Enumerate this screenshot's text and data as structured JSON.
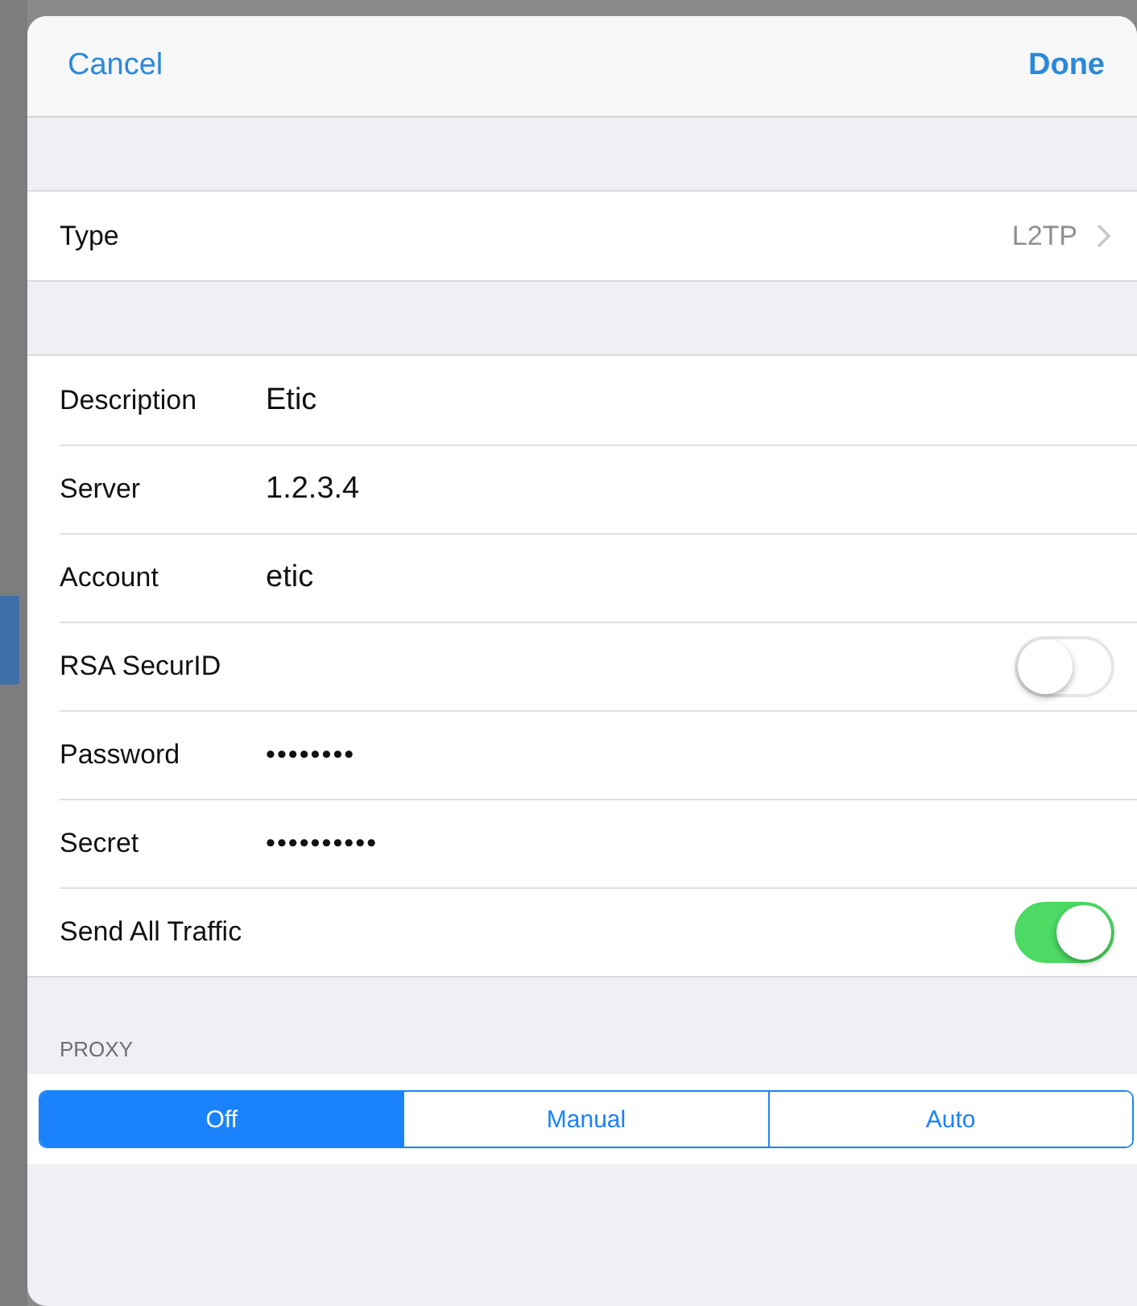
{
  "nav": {
    "cancel": "Cancel",
    "done": "Done"
  },
  "type_row": {
    "label": "Type",
    "value": "L2TP"
  },
  "fields": [
    {
      "kind": "text",
      "label": "Description",
      "value": "Etic"
    },
    {
      "kind": "text",
      "label": "Server",
      "value": "1.2.3.4"
    },
    {
      "kind": "text",
      "label": "Account",
      "value": "etic"
    },
    {
      "kind": "toggle",
      "label": "RSA SecurID",
      "on": false
    },
    {
      "kind": "secure",
      "label": "Password",
      "value": "••••••••"
    },
    {
      "kind": "secure",
      "label": "Secret",
      "value": "••••••••••"
    },
    {
      "kind": "toggle",
      "label": "Send All Traffic",
      "on": true
    }
  ],
  "proxy": {
    "header": "PROXY",
    "options": [
      {
        "label": "Off",
        "selected": true
      },
      {
        "label": "Manual",
        "selected": false
      },
      {
        "label": "Auto",
        "selected": false
      }
    ]
  }
}
